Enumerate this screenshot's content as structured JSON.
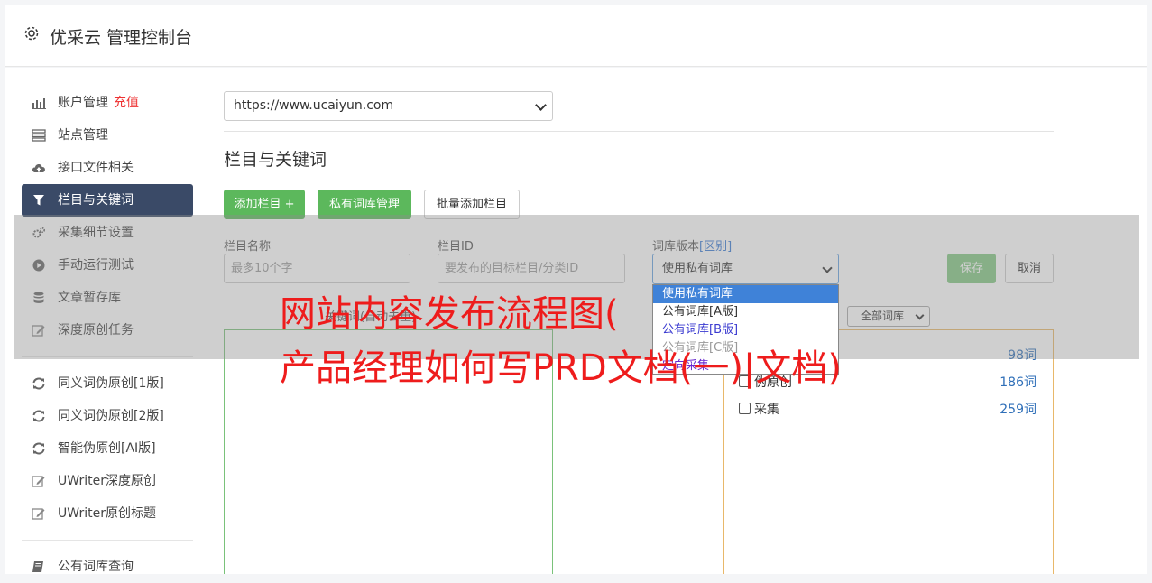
{
  "header": {
    "title": "优采云 管理控制台"
  },
  "sidebar": {
    "items": [
      {
        "label": "账户管理",
        "badge": "充值",
        "icon": "bar-chart-icon"
      },
      {
        "label": "站点管理",
        "icon": "server-icon"
      },
      {
        "label": "接口文件相关",
        "icon": "cloud-upload-icon"
      },
      {
        "label": "栏目与关键词",
        "icon": "filter-icon",
        "active": true
      },
      {
        "label": "采集细节设置",
        "icon": "cogs-icon"
      },
      {
        "label": "手动运行测试",
        "icon": "play-circle-icon"
      },
      {
        "label": "文章暂存库",
        "icon": "database-icon"
      },
      {
        "label": "深度原创任务",
        "icon": "edit-icon"
      }
    ],
    "items2": [
      {
        "label": "同义词伪原创[1版]",
        "icon": "refresh-icon"
      },
      {
        "label": "同义词伪原创[2版]",
        "icon": "refresh-icon"
      },
      {
        "label": "智能伪原创[AI版]",
        "icon": "refresh-icon"
      },
      {
        "label": "UWriter深度原创",
        "icon": "edit-icon"
      },
      {
        "label": "UWriter原创标题",
        "icon": "edit-icon"
      }
    ],
    "items3": [
      {
        "label": "公有词库查询",
        "icon": "book-icon"
      }
    ]
  },
  "site_select": {
    "value": "https://www.ucaiyun.com"
  },
  "section": {
    "title": "栏目与关键词"
  },
  "buttons": {
    "add_column": "添加栏目 +",
    "private_lib": "私有词库管理",
    "batch_add": "批量添加栏目",
    "save": "保存",
    "cancel": "取消"
  },
  "form": {
    "name_label": "栏目名称",
    "name_placeholder": "最多10个字",
    "id_label": "栏目ID",
    "id_placeholder": "要发布的目标栏目/分类ID",
    "lib_label": "词库版本",
    "lib_link": "[区别]",
    "lib_value": "使用私有词库",
    "lib_options": [
      "使用私有词库",
      "公有词库[A版]",
      "公有词库[B版]",
      "公有词库[C版]",
      "定向采集"
    ]
  },
  "keywords": {
    "label": "关键词(自动去重)"
  },
  "library": {
    "filter": "全部词库",
    "rows": [
      {
        "label": "",
        "count": "98词"
      },
      {
        "label": "伪原创",
        "count": "186词"
      },
      {
        "label": "采集",
        "count": "259词"
      }
    ]
  },
  "watermark": {
    "line1": "网站内容发布流程图(",
    "line2": "产品经理如何写PRD文档(一)|文档)"
  },
  "colors": {
    "accent": "#3a4a67",
    "green": "#5cb85c",
    "link": "#3a7bd5",
    "watermark": "#ee1c1c"
  }
}
